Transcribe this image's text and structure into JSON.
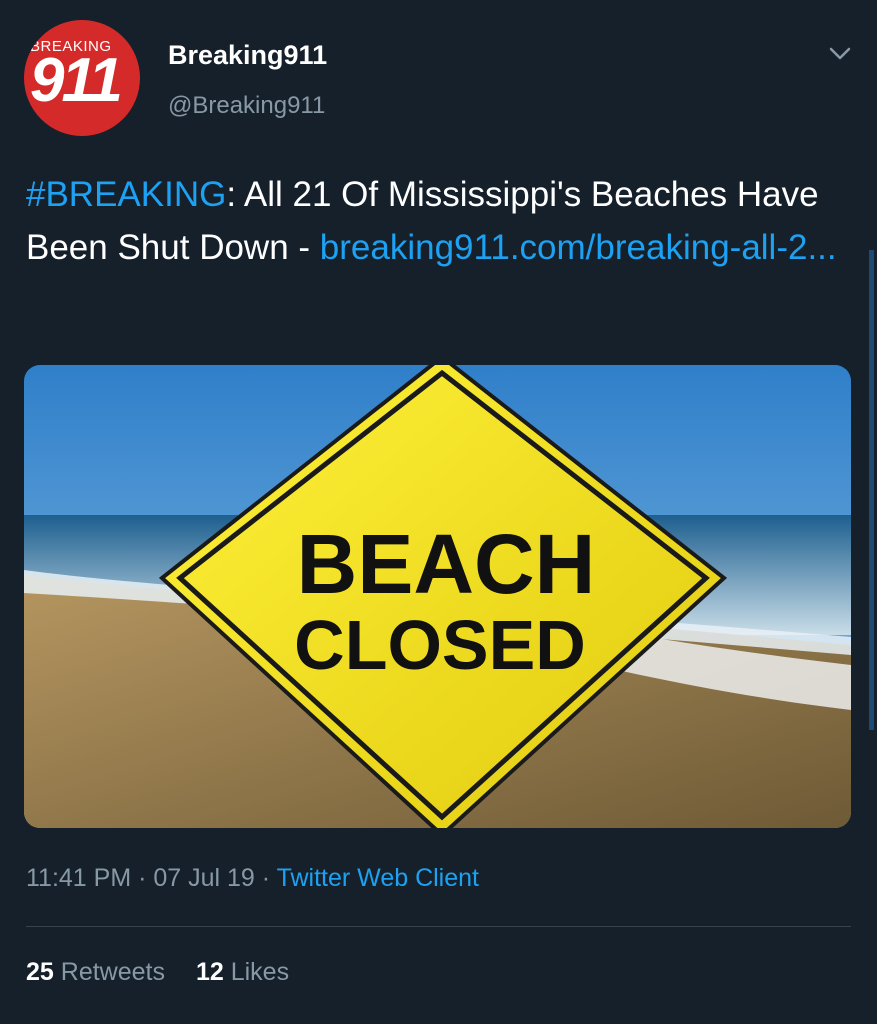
{
  "author": {
    "avatar_text_top": "BREAKING",
    "avatar_text_number": "911",
    "display_name": "Breaking911",
    "handle": "@Breaking911"
  },
  "tweet": {
    "hashtag": "#BREAKING",
    "text_after_hashtag": ": All 21 Of Mississippi's Beaches Have Been Shut Down - ",
    "link_text": "breaking911.com/breaking-all-2..."
  },
  "media": {
    "sign_line1": "BEACH",
    "sign_line2": "CLOSED"
  },
  "meta": {
    "time": "11:41 PM",
    "separator": " · ",
    "date": "07 Jul 19",
    "client": "Twitter Web Client"
  },
  "stats": {
    "retweets_count": "25",
    "retweets_label": "Retweets",
    "likes_count": "12",
    "likes_label": "Likes"
  },
  "colors": {
    "background": "#15202b",
    "accent": "#1da1f2",
    "secondary_text": "#8899a6",
    "avatar_red": "#d42a2a",
    "sign_yellow": "#f7e41a"
  },
  "icons": {
    "menu": "chevron-down-icon"
  }
}
